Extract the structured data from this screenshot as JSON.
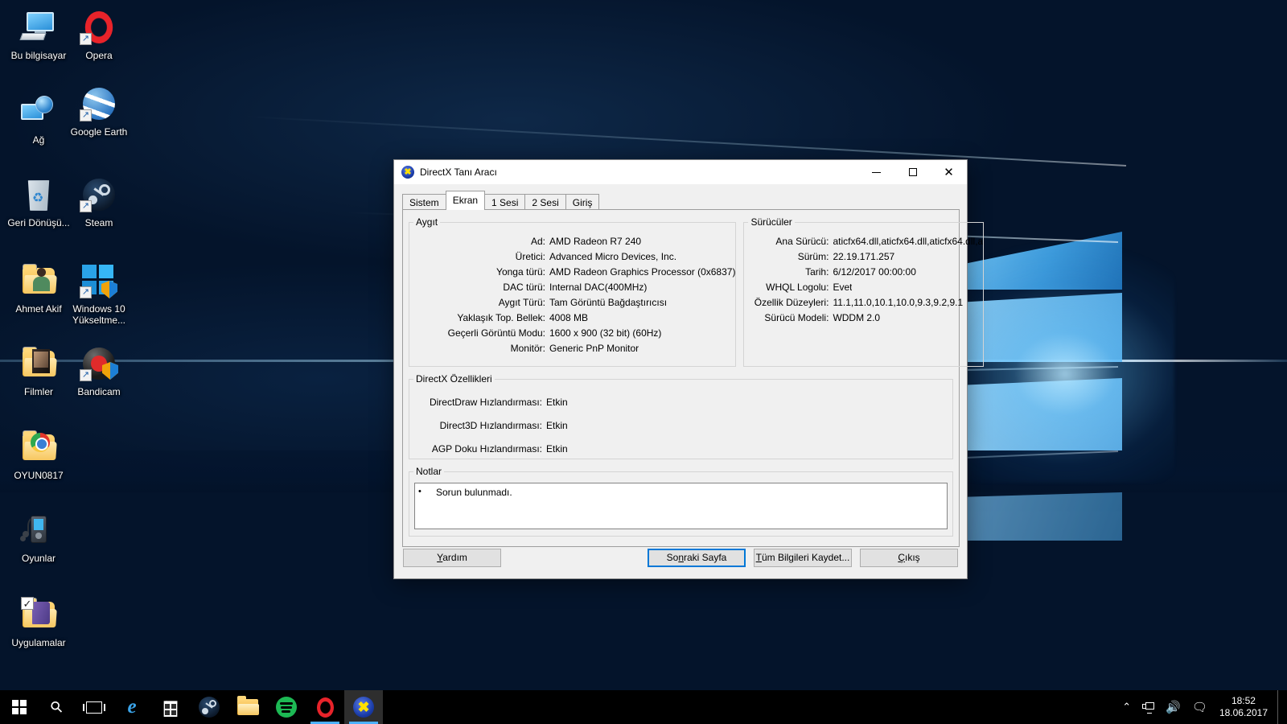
{
  "desktop": {
    "icons": [
      {
        "label": "Bu bilgisayar",
        "art": "pc",
        "shortcut": false
      },
      {
        "label": "Opera",
        "art": "opera",
        "shortcut": true
      },
      {
        "label": "Ağ",
        "art": "net",
        "shortcut": false
      },
      {
        "label": "Google Earth",
        "art": "earth",
        "shortcut": true
      },
      {
        "label": "Geri Dönüşü...",
        "art": "bin",
        "shortcut": false
      },
      {
        "label": "Steam",
        "art": "steam",
        "shortcut": true
      },
      {
        "label": "Ahmet Akif",
        "art": "person",
        "shortcut": false
      },
      {
        "label": "Windows 10 Yükseltme...",
        "art": "win10",
        "shortcut": true
      },
      {
        "label": "Filmler",
        "art": "film",
        "shortcut": false
      },
      {
        "label": "Bandicam",
        "art": "bandicam",
        "shortcut": true
      },
      {
        "label": "OYUN0817",
        "art": "chromefolder",
        "shortcut": false
      },
      {
        "label": "Oyunlar",
        "art": "mp3",
        "shortcut": false
      },
      {
        "label": "Uygulamalar",
        "art": "apps",
        "shortcut": false
      }
    ]
  },
  "taskbar": {
    "buttons": [
      {
        "name": "start-button",
        "icon": "windows-logo-icon"
      },
      {
        "name": "search-button",
        "icon": "search-icon"
      },
      {
        "name": "task-view-button",
        "icon": "task-view-icon"
      }
    ],
    "apps": [
      {
        "name": "taskbar-app-edge",
        "icon": "edge-icon",
        "state": "pinned"
      },
      {
        "name": "taskbar-app-store",
        "icon": "store-icon",
        "state": "pinned"
      },
      {
        "name": "taskbar-app-steam",
        "icon": "steam-icon",
        "state": "pinned"
      },
      {
        "name": "taskbar-app-file-explorer",
        "icon": "folder-icon",
        "state": "pinned"
      },
      {
        "name": "taskbar-app-spotify",
        "icon": "spotify-icon",
        "state": "pinned"
      },
      {
        "name": "taskbar-app-opera",
        "icon": "opera-icon",
        "state": "running"
      },
      {
        "name": "taskbar-app-dxdiag",
        "icon": "directx-icon",
        "state": "active"
      }
    ],
    "tray": {
      "chevron": "︿",
      "icons": [
        "network-icon",
        "volume-icon",
        "action-center-icon"
      ],
      "clock_time": "18:52",
      "clock_date": "18.06.2017"
    }
  },
  "dialog": {
    "title": "DirectX Tanı Aracı",
    "icon": "directx-icon",
    "window_controls": {
      "minimize": "minimize-icon",
      "maximize": "maximize-icon",
      "close": "✕"
    },
    "tabs": [
      {
        "label": "Sistem",
        "active": false
      },
      {
        "label": "Ekran",
        "active": true
      },
      {
        "label": "1 Sesi",
        "active": false
      },
      {
        "label": "2 Sesi",
        "active": false
      },
      {
        "label": "Giriş",
        "active": false
      }
    ],
    "device": {
      "legend": "Aygıt",
      "rows": [
        {
          "label": "Ad:",
          "value": "AMD Radeon R7 240"
        },
        {
          "label": "Üretici:",
          "value": "Advanced Micro Devices, Inc."
        },
        {
          "label": "Yonga türü:",
          "value": "AMD Radeon Graphics Processor (0x6837)"
        },
        {
          "label": "DAC türü:",
          "value": "Internal DAC(400MHz)"
        },
        {
          "label": "Aygıt Türü:",
          "value": "Tam Görüntü Bağdaştırıcısı"
        },
        {
          "label": "Yaklaşık Top. Bellek:",
          "value": "4008 MB"
        },
        {
          "label": "Geçerli Görüntü Modu:",
          "value": "1600 x 900 (32 bit) (60Hz)"
        },
        {
          "label": "Monitör:",
          "value": "Generic PnP Monitor"
        }
      ]
    },
    "drivers": {
      "legend": "Sürücüler",
      "rows": [
        {
          "label": "Ana Sürücü:",
          "value": "aticfx64.dll,aticfx64.dll,aticfx64.dll,a"
        },
        {
          "label": "Sürüm:",
          "value": "22.19.171.257"
        },
        {
          "label": "Tarih:",
          "value": "6/12/2017 00:00:00"
        },
        {
          "label": "WHQL Logolu:",
          "value": "Evet"
        },
        {
          "label": "Özellik Düzeyleri:",
          "value": "11.1,11.0,10.1,10.0,9.3,9.2,9.1"
        },
        {
          "label": "Sürücü Modeli:",
          "value": "WDDM 2.0"
        }
      ]
    },
    "features": {
      "legend": "DirectX Özellikleri",
      "rows": [
        {
          "label": "DirectDraw Hızlandırması:",
          "value": "Etkin"
        },
        {
          "label": "Direct3D Hızlandırması:",
          "value": "Etkin"
        },
        {
          "label": "AGP Doku Hızlandırması:",
          "value": "Etkin"
        }
      ]
    },
    "notes": {
      "legend": "Notlar",
      "bullet": "•",
      "text": "Sorun bulunmadı."
    },
    "buttons": {
      "help": "Yardım",
      "help_accel": "Y",
      "next": "Sonraki Sayfa",
      "next_accel": "n",
      "save": "Tüm Bilgileri Kaydet...",
      "save_accel": "T",
      "exit": "Çıkış",
      "exit_accel": "Ç"
    }
  },
  "colors": {
    "accent": "#0078d7",
    "taskbar": "#000000",
    "dialog_bg": "#f0f0f0"
  }
}
